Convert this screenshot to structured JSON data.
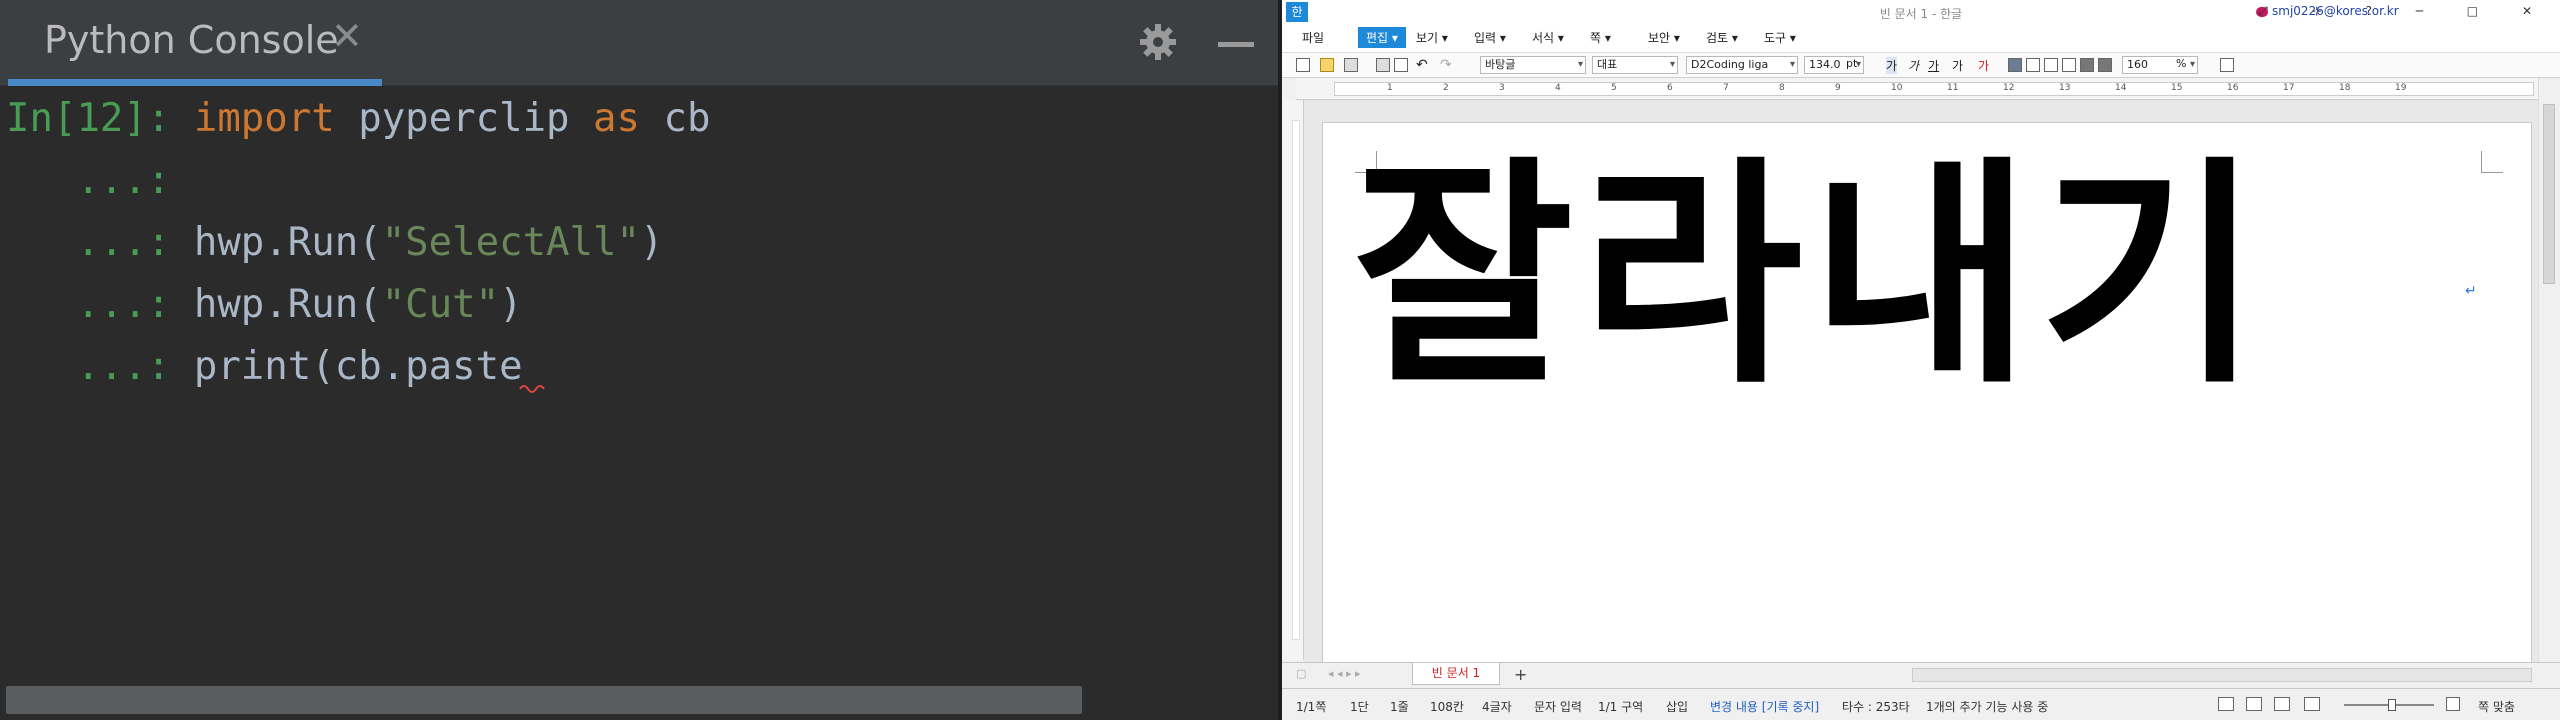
{
  "console": {
    "tab_title": "Python Console",
    "close_glyph": "✕",
    "gear_icon": "gear-icon",
    "minimize_icon": "minimize-icon",
    "lines": [
      {
        "prompt": "In[12]:",
        "parts": [
          {
            "t": "kw",
            "v": "import"
          },
          {
            "t": "plain",
            "v": " pyperclip "
          },
          {
            "t": "kw",
            "v": "as"
          },
          {
            "t": "plain",
            "v": " cb"
          }
        ]
      },
      {
        "prompt": "   ...:",
        "parts": []
      },
      {
        "prompt": "   ...:",
        "parts": [
          {
            "t": "plain",
            "v": "hwp.Run("
          },
          {
            "t": "str",
            "v": "\"SelectAll\""
          },
          {
            "t": "plain",
            "v": ")"
          }
        ]
      },
      {
        "prompt": "   ...:",
        "parts": [
          {
            "t": "plain",
            "v": "hwp.Run("
          },
          {
            "t": "str",
            "v": "\"Cut\""
          },
          {
            "t": "plain",
            "v": ")"
          }
        ]
      },
      {
        "prompt": "   ...:",
        "parts": [
          {
            "t": "plain",
            "v": "print(cb.paste"
          }
        ]
      }
    ],
    "colors": {
      "prompt": "#499c54",
      "keyword": "#cc7832",
      "string": "#6a8759",
      "text": "#a9b7c6",
      "background": "#2b2b2b"
    }
  },
  "hwp": {
    "window_title": "빈 문서 1 - 한글",
    "app_logo": "한",
    "user": "smj0226@kores.or.kr",
    "window_buttons": "⤢ ⊹ ? ─ □ ✕",
    "menus": [
      "파일",
      "편집",
      "보기",
      "입력",
      "서식",
      "쪽",
      "보안",
      "검토",
      "도구"
    ],
    "active_menu": "편집",
    "toolbar": {
      "style": "바탕글",
      "para_style": "대표",
      "font": "D2Coding liga",
      "font_size": "134.0",
      "font_unit": "pt",
      "line_spacing": "160",
      "spacing_unit": "%",
      "format_buttons": [
        "가",
        "가",
        "가",
        "가",
        "가"
      ]
    },
    "ruler_numbers": [
      "1",
      "2",
      "3",
      "4",
      "5",
      "6",
      "7",
      "8",
      "9",
      "10",
      "11",
      "12",
      "13",
      "14",
      "15",
      "16",
      "17",
      "18",
      "19"
    ],
    "document_text": "잘라내기",
    "paragraph_mark": "↵",
    "doc_tab": "빈 문서 1",
    "add_tab": "+",
    "status": {
      "page": "1/1쪽",
      "section_col": "1단",
      "line": "1줄",
      "column": "108칸",
      "chars": "4글자",
      "input_mode": "문자 입력",
      "zone": "1/1 구역",
      "insert": "삽입",
      "track_changes": "변경 내용 [기록 중지]",
      "typing_count": "타수 : 253타",
      "extra": "1개의 추가 기능 사용 중",
      "fit": "쪽 맞춤"
    },
    "colors": {
      "accent": "#1e88d9",
      "tab_text": "#d02020",
      "status_blue": "#1f5fc4"
    }
  }
}
